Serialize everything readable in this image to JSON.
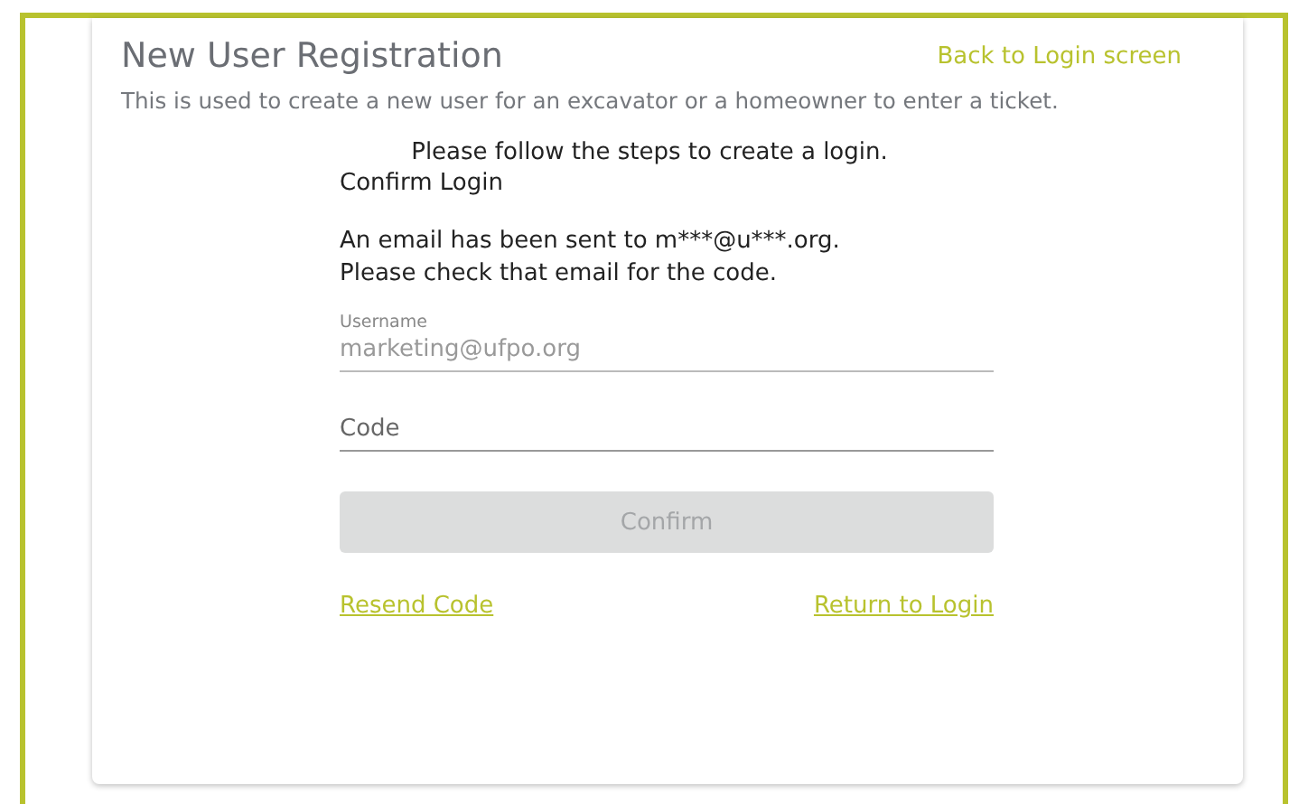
{
  "header": {
    "title": "New User Registration",
    "back_link": "Back to Login screen",
    "description": "This is used to create a new user for an excavator or a homeowner to enter a ticket."
  },
  "form": {
    "intro": "Please follow the steps to create a login.",
    "step_title": "Confirm Login",
    "message_lines": [
      "An email has been sent to m***@u***.org.",
      "Please check that email for the code."
    ],
    "fields": [
      {
        "label": "Username",
        "value": "marketing@ufpo.org",
        "disabled": true
      },
      {
        "placeholder": "Code",
        "disabled": false
      }
    ],
    "confirm_button": {
      "label": "Confirm",
      "disabled": true
    },
    "links": [
      "Resend Code",
      "Return to Login"
    ]
  }
}
